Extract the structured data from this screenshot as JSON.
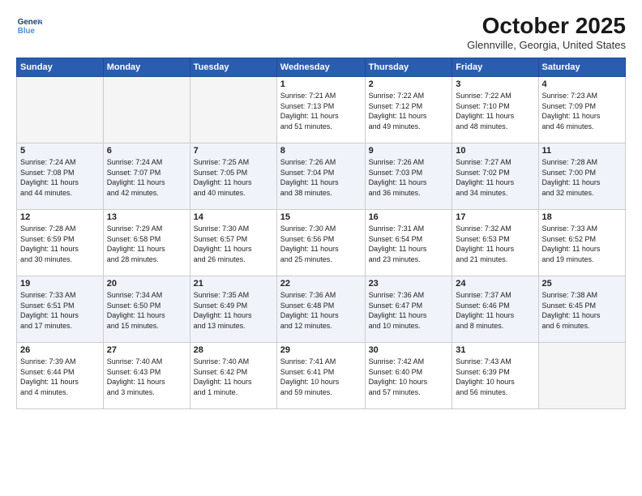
{
  "logo": {
    "line1": "General",
    "line2": "Blue"
  },
  "title": "October 2025",
  "subtitle": "Glennville, Georgia, United States",
  "days_of_week": [
    "Sunday",
    "Monday",
    "Tuesday",
    "Wednesday",
    "Thursday",
    "Friday",
    "Saturday"
  ],
  "weeks": [
    [
      {
        "day": "",
        "info": ""
      },
      {
        "day": "",
        "info": ""
      },
      {
        "day": "",
        "info": ""
      },
      {
        "day": "1",
        "info": "Sunrise: 7:21 AM\nSunset: 7:13 PM\nDaylight: 11 hours\nand 51 minutes."
      },
      {
        "day": "2",
        "info": "Sunrise: 7:22 AM\nSunset: 7:12 PM\nDaylight: 11 hours\nand 49 minutes."
      },
      {
        "day": "3",
        "info": "Sunrise: 7:22 AM\nSunset: 7:10 PM\nDaylight: 11 hours\nand 48 minutes."
      },
      {
        "day": "4",
        "info": "Sunrise: 7:23 AM\nSunset: 7:09 PM\nDaylight: 11 hours\nand 46 minutes."
      }
    ],
    [
      {
        "day": "5",
        "info": "Sunrise: 7:24 AM\nSunset: 7:08 PM\nDaylight: 11 hours\nand 44 minutes."
      },
      {
        "day": "6",
        "info": "Sunrise: 7:24 AM\nSunset: 7:07 PM\nDaylight: 11 hours\nand 42 minutes."
      },
      {
        "day": "7",
        "info": "Sunrise: 7:25 AM\nSunset: 7:05 PM\nDaylight: 11 hours\nand 40 minutes."
      },
      {
        "day": "8",
        "info": "Sunrise: 7:26 AM\nSunset: 7:04 PM\nDaylight: 11 hours\nand 38 minutes."
      },
      {
        "day": "9",
        "info": "Sunrise: 7:26 AM\nSunset: 7:03 PM\nDaylight: 11 hours\nand 36 minutes."
      },
      {
        "day": "10",
        "info": "Sunrise: 7:27 AM\nSunset: 7:02 PM\nDaylight: 11 hours\nand 34 minutes."
      },
      {
        "day": "11",
        "info": "Sunrise: 7:28 AM\nSunset: 7:00 PM\nDaylight: 11 hours\nand 32 minutes."
      }
    ],
    [
      {
        "day": "12",
        "info": "Sunrise: 7:28 AM\nSunset: 6:59 PM\nDaylight: 11 hours\nand 30 minutes."
      },
      {
        "day": "13",
        "info": "Sunrise: 7:29 AM\nSunset: 6:58 PM\nDaylight: 11 hours\nand 28 minutes."
      },
      {
        "day": "14",
        "info": "Sunrise: 7:30 AM\nSunset: 6:57 PM\nDaylight: 11 hours\nand 26 minutes."
      },
      {
        "day": "15",
        "info": "Sunrise: 7:30 AM\nSunset: 6:56 PM\nDaylight: 11 hours\nand 25 minutes."
      },
      {
        "day": "16",
        "info": "Sunrise: 7:31 AM\nSunset: 6:54 PM\nDaylight: 11 hours\nand 23 minutes."
      },
      {
        "day": "17",
        "info": "Sunrise: 7:32 AM\nSunset: 6:53 PM\nDaylight: 11 hours\nand 21 minutes."
      },
      {
        "day": "18",
        "info": "Sunrise: 7:33 AM\nSunset: 6:52 PM\nDaylight: 11 hours\nand 19 minutes."
      }
    ],
    [
      {
        "day": "19",
        "info": "Sunrise: 7:33 AM\nSunset: 6:51 PM\nDaylight: 11 hours\nand 17 minutes."
      },
      {
        "day": "20",
        "info": "Sunrise: 7:34 AM\nSunset: 6:50 PM\nDaylight: 11 hours\nand 15 minutes."
      },
      {
        "day": "21",
        "info": "Sunrise: 7:35 AM\nSunset: 6:49 PM\nDaylight: 11 hours\nand 13 minutes."
      },
      {
        "day": "22",
        "info": "Sunrise: 7:36 AM\nSunset: 6:48 PM\nDaylight: 11 hours\nand 12 minutes."
      },
      {
        "day": "23",
        "info": "Sunrise: 7:36 AM\nSunset: 6:47 PM\nDaylight: 11 hours\nand 10 minutes."
      },
      {
        "day": "24",
        "info": "Sunrise: 7:37 AM\nSunset: 6:46 PM\nDaylight: 11 hours\nand 8 minutes."
      },
      {
        "day": "25",
        "info": "Sunrise: 7:38 AM\nSunset: 6:45 PM\nDaylight: 11 hours\nand 6 minutes."
      }
    ],
    [
      {
        "day": "26",
        "info": "Sunrise: 7:39 AM\nSunset: 6:44 PM\nDaylight: 11 hours\nand 4 minutes."
      },
      {
        "day": "27",
        "info": "Sunrise: 7:40 AM\nSunset: 6:43 PM\nDaylight: 11 hours\nand 3 minutes."
      },
      {
        "day": "28",
        "info": "Sunrise: 7:40 AM\nSunset: 6:42 PM\nDaylight: 11 hours\nand 1 minute."
      },
      {
        "day": "29",
        "info": "Sunrise: 7:41 AM\nSunset: 6:41 PM\nDaylight: 10 hours\nand 59 minutes."
      },
      {
        "day": "30",
        "info": "Sunrise: 7:42 AM\nSunset: 6:40 PM\nDaylight: 10 hours\nand 57 minutes."
      },
      {
        "day": "31",
        "info": "Sunrise: 7:43 AM\nSunset: 6:39 PM\nDaylight: 10 hours\nand 56 minutes."
      },
      {
        "day": "",
        "info": ""
      }
    ]
  ]
}
